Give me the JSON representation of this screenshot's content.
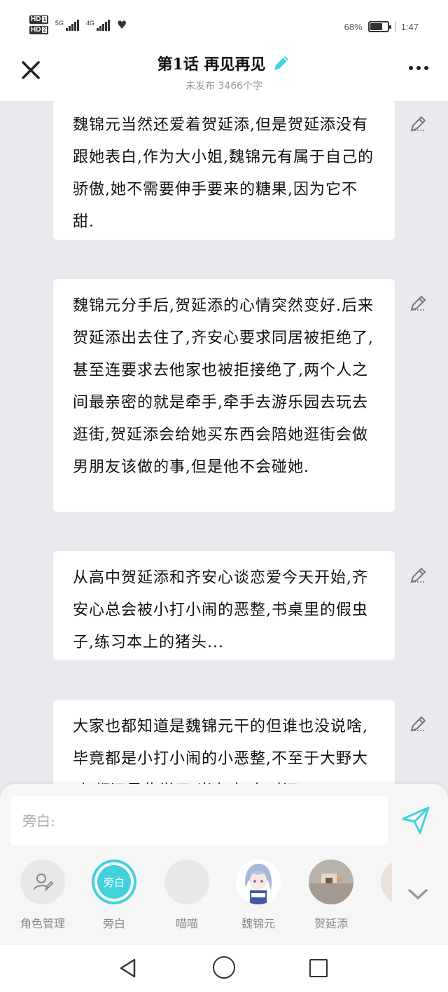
{
  "status_bar": {
    "hd1": "HD",
    "hd1_sub": "1",
    "hd2": "HD",
    "hd2_sub": "2",
    "net1": "5G",
    "net2": "4G",
    "battery": "68%",
    "battery_level": 0.68,
    "time": "1:47"
  },
  "header": {
    "title": "第1话 再见再见",
    "subtitle": "未发布 3466个字",
    "accent_color": "#43d2dc"
  },
  "cards": [
    {
      "text": "魏锦元当然还爱着贺延添,但是贺延添没有跟她表白,作为大小姐,魏锦元有属于自己的骄傲,她不需要伸手要来的糖果,因为它不甜."
    },
    {
      "text": "魏锦元分手后,贺延添的心情突然变好.后来贺延添出去住了,齐安心要求同居被拒绝了,甚至连要求去他家也被拒接绝了,两个人之间最亲密的就是牵手,牵手去游乐园去玩去逛街,贺延添会给她买东西会陪她逛街会做男朋友该做的事,但是他不会碰她."
    },
    {
      "text": "从高中贺延添和齐安心谈恋爱今天开始,齐安心总会被小打小闹的恶整,书桌里的假虫子,练习本上的猪头..."
    },
    {
      "text": "大家也都知道是魏锦元干的但谁也没说啥,毕竟都是小打小闹的小恶整,不至于大野大动,都还是些学子,当有事,有时还"
    }
  ],
  "composer": {
    "placeholder": "旁白:"
  },
  "roles": [
    {
      "label": "角色管理",
      "icon": "user-edit-icon"
    },
    {
      "label": "旁白",
      "badge": "旁白",
      "selected": true
    },
    {
      "label": "喵喵"
    },
    {
      "label": "魏锦元",
      "icon": "anime-girl-avatar"
    },
    {
      "label": "贺延添",
      "icon": "photo-avatar"
    }
  ]
}
